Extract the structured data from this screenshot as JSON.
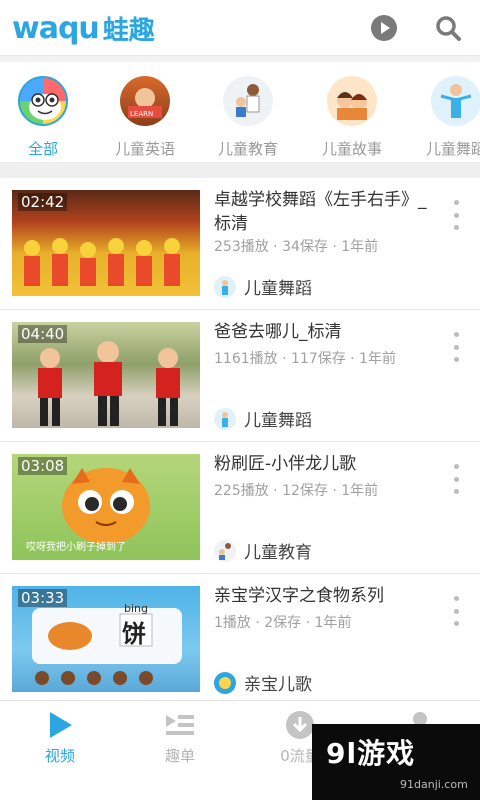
{
  "header": {
    "logo_latin": "waqu",
    "logo_cn": "蛙趣",
    "icons": [
      "play-circle-icon",
      "search-icon"
    ],
    "accent": "#2ba6e0"
  },
  "categories": [
    {
      "label": "全部",
      "active": true
    },
    {
      "label": "儿童英语",
      "active": false
    },
    {
      "label": "儿童教育",
      "active": false
    },
    {
      "label": "儿童故事",
      "active": false
    },
    {
      "label": "儿童舞蹈",
      "active": false
    }
  ],
  "videos": [
    {
      "duration": "02:42",
      "title": "卓越学校舞蹈《左手右手》_标清",
      "meta": "253播放 · 34保存 · 1年前",
      "channel": "儿童舞蹈"
    },
    {
      "duration": "04:40",
      "title": "爸爸去哪儿_标清",
      "meta": "1161播放 · 117保存 · 1年前",
      "channel": "儿童舞蹈"
    },
    {
      "duration": "03:08",
      "title": "粉刷匠-小伴龙儿歌",
      "meta": "225播放 · 12保存 · 1年前",
      "channel": "儿童教育"
    },
    {
      "duration": "03:33",
      "title": "亲宝学汉字之食物系列",
      "meta": "1播放 · 2保存 · 1年前",
      "channel": "亲宝儿歌"
    }
  ],
  "thumb_text": {
    "v3_subtitle": "哎呀我把小刷子掉到了",
    "v4_pinyin": "bing",
    "v4_char": "饼"
  },
  "bottom_nav": [
    {
      "label": "视频",
      "icon": "play-icon",
      "active": true
    },
    {
      "label": "趣单",
      "icon": "playlist-icon",
      "active": false
    },
    {
      "label": "0流量",
      "icon": "download-icon",
      "active": false
    },
    {
      "label": "",
      "icon": "user-icon",
      "active": false
    }
  ],
  "watermark": {
    "main": "9l游戏",
    "sub": "91danji.com"
  }
}
